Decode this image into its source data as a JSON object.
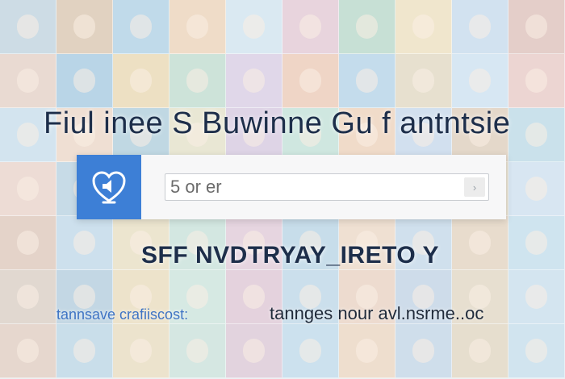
{
  "hero": {
    "title": "Fiul inee S Buwinne Gu f antntsie",
    "headline": "SFF NVDTRYAY_IRETO Y"
  },
  "search": {
    "brand_icon": "heart-speaker-icon",
    "value": "5 or er",
    "button_label": "›"
  },
  "links": {
    "left": "tannsave crafiiscost:",
    "right": "tannges nour avl.nsrme..oc"
  },
  "colors": {
    "brand_blue": "#3d7fd6",
    "title_navy": "#1d2e4a",
    "link_blue": "#3f74c4"
  },
  "background_tiles": [
    "#9bb9c9",
    "#c8a27a",
    "#7fb3d5",
    "#e6b98a",
    "#b9d6e6",
    "#d8a6b8",
    "#8fc1a6",
    "#e9cf96",
    "#a7c5e3",
    "#cf9a8c",
    "#d9b4a0",
    "#6fa9cf",
    "#e2c27e",
    "#9cc7b0",
    "#c6aed2",
    "#e7a985",
    "#88b9d9",
    "#d4c19a",
    "#b2d1e8",
    "#e0a8a0",
    "#a9cbe0",
    "#e6bfa2",
    "#7eb0c6",
    "#d9d0a4",
    "#c1a6cc",
    "#9fd0bf",
    "#e8b68c",
    "#a6c0e0",
    "#cfb08f",
    "#95c4d8",
    "#e2b8a6",
    "#8eb7cf",
    "#d6c48f",
    "#b6d7c5",
    "#c99fb0",
    "#a1c8e2",
    "#e4bd8f",
    "#90b4d0",
    "#dac5a1",
    "#b4cfe6",
    "#cfa58d",
    "#9cc2dc",
    "#e0cc9a",
    "#a8d0c0",
    "#d2a9bf",
    "#8fbad6",
    "#e6c0a0",
    "#a3c2db",
    "#d8b995",
    "#9fcbe1",
    "#c7b09c",
    "#86aec8",
    "#e3c790",
    "#b0d4c6",
    "#cea3b9",
    "#97bfd9",
    "#e2b69a",
    "#9db8d4",
    "#d5bf9b",
    "#aacde3",
    "#d2ad98",
    "#93bdd6",
    "#dfc894",
    "#aed0c4",
    "#c9a4ba",
    "#9ac3dd",
    "#e5bc98",
    "#a0bcd7",
    "#d3bd97",
    "#a5cbe0"
  ]
}
